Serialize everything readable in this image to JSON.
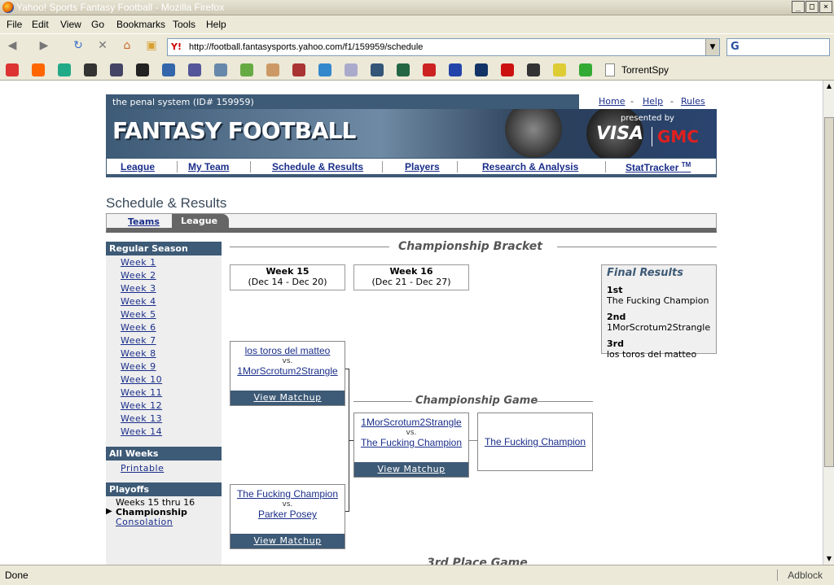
{
  "window": {
    "title": "Yahoo! Sports Fantasy Football - Mozilla Firefox"
  },
  "menu": [
    "File",
    "Edit",
    "View",
    "Go",
    "Bookmarks",
    "Tools",
    "Help"
  ],
  "address": {
    "url": "http://football.fantasysports.yahoo.com/f1/159959/schedule"
  },
  "bookmarks": {
    "last": "TorrentSpy"
  },
  "header": {
    "league": "the penal system  (ID# 159959)",
    "home": "Home",
    "help": "Help",
    "rules": "Rules",
    "title": "FANTASY FOOTBALL",
    "presented_by": "presented by",
    "sponsor1": "VISA",
    "sponsor2": "GMC"
  },
  "nav": [
    "League",
    "My Team",
    "Schedule & Results",
    "Players",
    "Research & Analysis",
    "StatTracker"
  ],
  "nav_tm": "TM",
  "page_title": "Schedule & Results",
  "tabs": {
    "teams": "Teams",
    "league": "League"
  },
  "sidebar": {
    "regular": "Regular Season",
    "weeks": [
      "Week 1",
      "Week 2",
      "Week 3",
      "Week 4",
      "Week 5",
      "Week 6",
      "Week 7",
      "Week 8",
      "Week 9",
      "Week 10",
      "Week 11",
      "Week 12",
      "Week 13",
      "Week 14"
    ],
    "all": "All Weeks",
    "printable": "Printable",
    "playoffs": "Playoffs",
    "p1": "Weeks 15 thru 16",
    "p2": "Championship",
    "p3": "Consolation"
  },
  "bracket": {
    "title": "Championship Bracket",
    "week15": {
      "label": "Week 15",
      "dates": "(Dec 14 - Dec 20)"
    },
    "week16": {
      "label": "Week 16",
      "dates": "(Dec 21 - Dec 27)"
    },
    "m1": {
      "a": "los toros del matteo",
      "b": "1MorScrotum2Strangle"
    },
    "m2": {
      "a": "The Fucking Champion",
      "b": "Parker Posey"
    },
    "champ_title": "Championship Game",
    "m3": {
      "a": "1MorScrotum2Strangle",
      "b": "The Fucking Champion"
    },
    "winner": "The Fucking Champion",
    "vs": "vs.",
    "view": "View Matchup",
    "third": "3rd Place Game"
  },
  "final": {
    "title": "Final Results",
    "p1": "1st",
    "n1": "The Fucking Champion",
    "p2": "2nd",
    "n2": "1MorScrotum2Strangle",
    "p3": "3rd",
    "n3": "los toros del matteo"
  },
  "status": {
    "text": "Done",
    "addon": "Adblock"
  }
}
